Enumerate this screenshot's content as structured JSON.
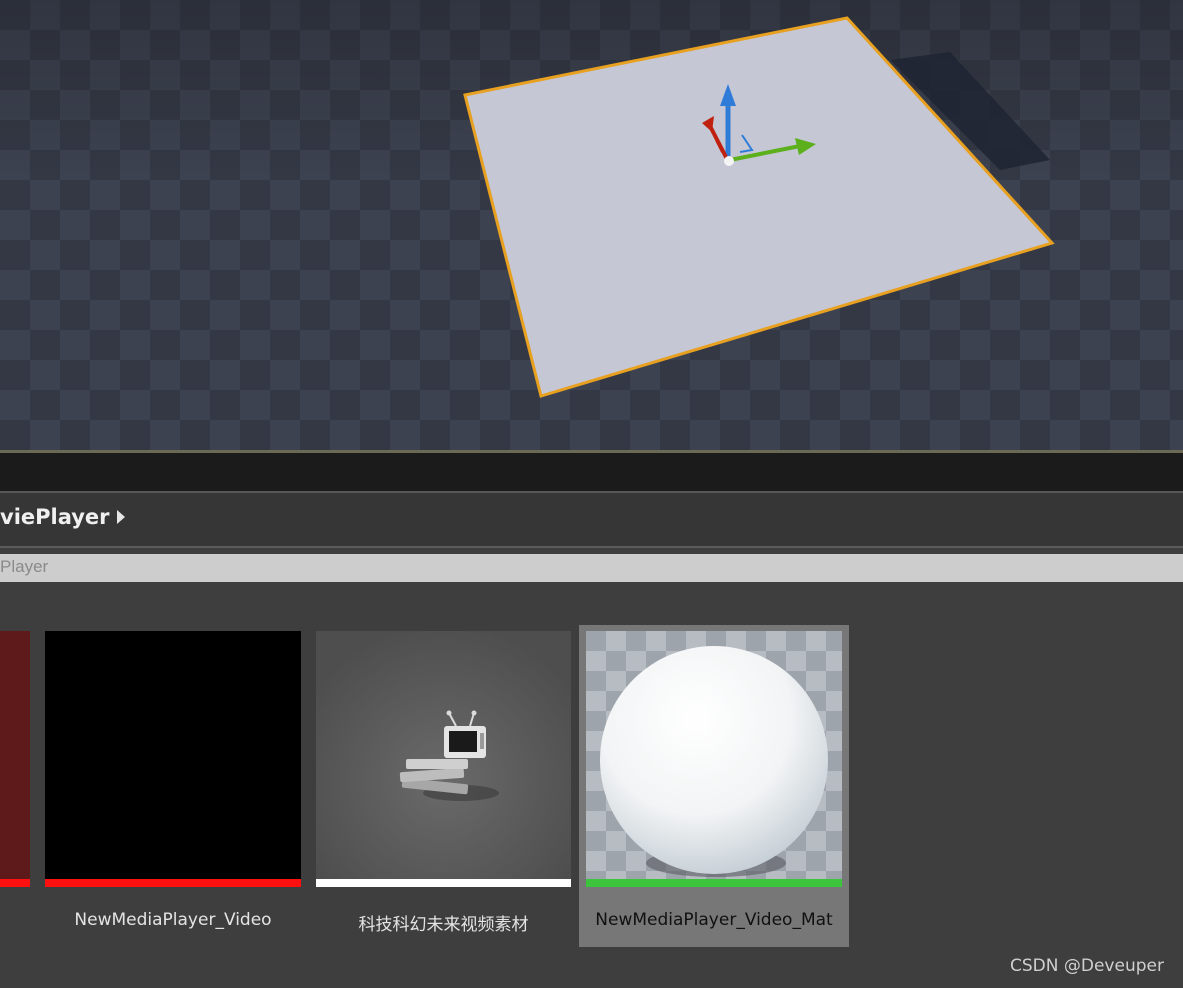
{
  "viewport": {
    "name": "level-viewport",
    "selected_actor": "plane",
    "outline_color": "#e8a020",
    "gizmo_colors": {
      "x": "#c02010",
      "y": "#5bb01c",
      "z": "#2f7cd8"
    }
  },
  "content_browser": {
    "breadcrumb": "viePlayer",
    "search_value": "Player",
    "assets": [
      {
        "label": "",
        "thumb": "red-partial",
        "stripe_color": "#ff1010"
      },
      {
        "label": "NewMediaPlayer_Video",
        "thumb": "black",
        "stripe_color": "#ff1010"
      },
      {
        "label": "科技科幻未来视频素材",
        "thumb": "media-source-tv-icon",
        "stripe_color": "#ffffff"
      },
      {
        "label": "NewMediaPlayer_Video_Mat",
        "thumb": "material-sphere",
        "stripe_color": "#3cc43c",
        "selected": true
      }
    ]
  },
  "watermark": "CSDN @Deveuper"
}
